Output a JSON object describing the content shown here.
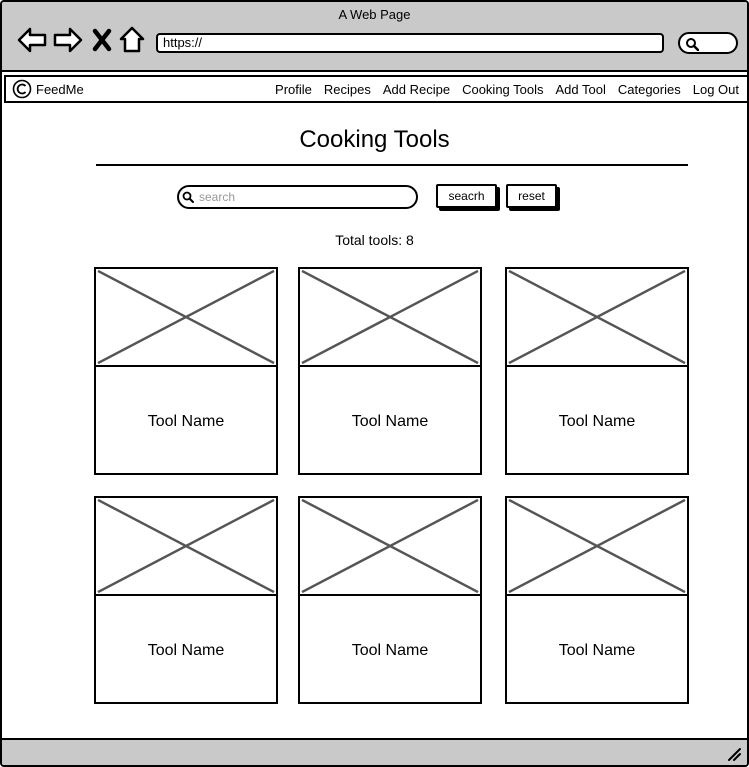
{
  "browser": {
    "title": "A Web Page",
    "url": "https://"
  },
  "navbar": {
    "brand": "FeedMe",
    "links": [
      "Profile",
      "Recipes",
      "Add Recipe",
      "Cooking Tools",
      "Add Tool",
      "Categories",
      "Log Out"
    ]
  },
  "page": {
    "title": "Cooking Tools",
    "search_placeholder": "search",
    "search_button": "seacrh",
    "reset_button": "reset",
    "total_text": "Total tools: 8"
  },
  "tools": [
    {
      "name": "Tool Name"
    },
    {
      "name": "Tool Name"
    },
    {
      "name": "Tool Name"
    },
    {
      "name": "Tool Name"
    },
    {
      "name": "Tool Name"
    },
    {
      "name": "Tool Name"
    }
  ]
}
